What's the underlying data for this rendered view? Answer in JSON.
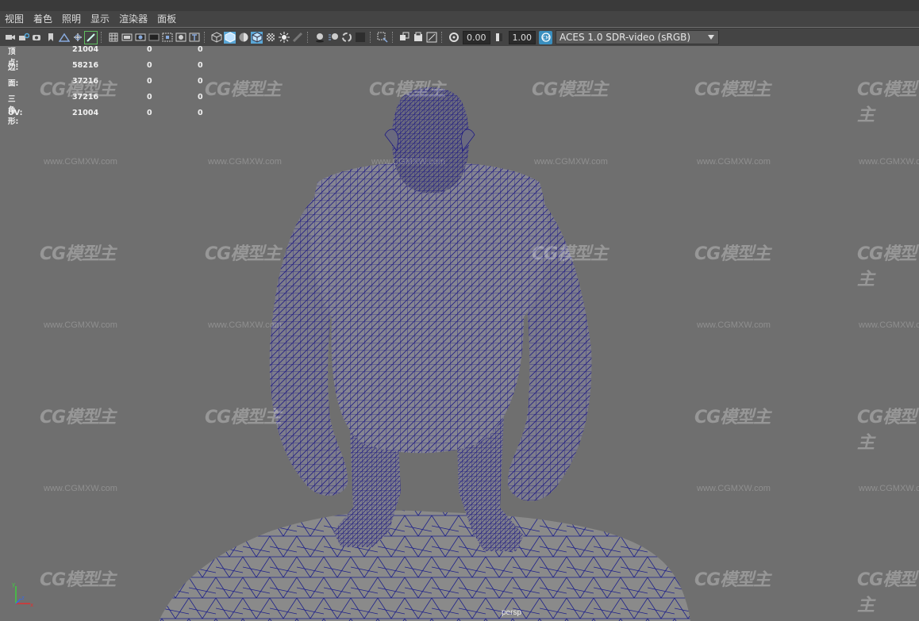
{
  "menus": [
    "视图",
    "着色",
    "照明",
    "显示",
    "渲染器",
    "面板"
  ],
  "toolbar": {
    "exposure": "0.00",
    "gamma": "1.00",
    "colorspace": "ACES 1.0 SDR-video (sRGB)",
    "icons": [
      "camera-icon",
      "camera-lock-icon",
      "camera-attr-icon",
      "bookmark-icon",
      "image-plane-icon",
      "2d-pan-icon",
      "grease-pencil-icon",
      "grid-icon",
      "film-gate-icon",
      "resolution-gate-icon",
      "gate-mask-icon",
      "field-chart-icon",
      "safe-action-icon",
      "safe-title-icon",
      "wireframe-icon",
      "smooth-shade-icon",
      "use-default-material-icon",
      "wireframe-on-shaded-icon",
      "xray-icon",
      "all-lights-icon",
      "shadows-icon",
      "ambient-occlusion-icon",
      "motion-blur-icon",
      "anti-aliasing-icon",
      "isolate-select-icon",
      "xray-joints-icon",
      "xray-active-icon",
      "component-icon",
      "exposure-icon",
      "gamma-icon",
      "color-management-icon"
    ]
  },
  "hud": {
    "rows": [
      {
        "label": "顶点:",
        "v1": "21004",
        "v2": "0",
        "v3": "0"
      },
      {
        "label": "边:",
        "v1": "58216",
        "v2": "0",
        "v3": "0"
      },
      {
        "label": "面:",
        "v1": "37216",
        "v2": "0",
        "v3": "0"
      },
      {
        "label": "三角形:",
        "v1": "37216",
        "v2": "0",
        "v3": "0"
      },
      {
        "label": "UV:",
        "v1": "21004",
        "v2": "0",
        "v3": "0"
      }
    ]
  },
  "watermark": {
    "logo": "CG模型主",
    "url": "www.CGMXW.com"
  },
  "camera_label": "persp",
  "axis": {
    "x": "x",
    "y": "y",
    "z": "z"
  },
  "colors": {
    "viewport_bg": "#6f6f6f",
    "wire": "#1f1b82",
    "rock_wire": "#1c1f8a",
    "menubar_bg": "#444444"
  }
}
